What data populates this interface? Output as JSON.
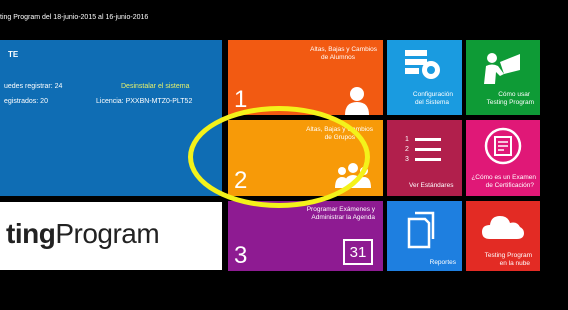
{
  "header": {
    "text": "ting Program del 18-junio-2015 al 16-junio-2016"
  },
  "panel": {
    "title": "TE",
    "can_register": "uedes registrar: 24",
    "uninstall_link": "Desinstalar el sistema",
    "registered": "egistrados: 20",
    "license": "Licencia: PXXBN-MTZ0-PLT52"
  },
  "brand": {
    "bold": "ting",
    "light": "Program"
  },
  "tiles": {
    "altas_alumnos": {
      "label1": "Altas, Bajas y Cambios",
      "label2": "de Alumnos",
      "number": "1"
    },
    "altas_grupos": {
      "label1": "Altas, Bajas y Cambios",
      "label2": "de Grupos",
      "number": "2"
    },
    "programar_agenda": {
      "label1": "Programar Exámenes y",
      "label2": "Administrar la Agenda",
      "number": "3",
      "calendar_day": "31"
    },
    "configuracion": {
      "label1": "Configuración",
      "label2": "del Sistema"
    },
    "como_usar": {
      "label1": "Cómo usar",
      "label2": "Testing Program"
    },
    "ver_estandares": {
      "label": "Ver Estándares",
      "list_nums": [
        "1",
        "2",
        "3"
      ]
    },
    "examen": {
      "label1": "¿Cómo es un  Examen",
      "label2": "de Certificación?"
    },
    "reportes": {
      "label": "Reportes"
    },
    "nube": {
      "label1": "Testing Program",
      "label2": "en la nube"
    }
  },
  "colors": {
    "highlight": "#f4f21a",
    "orange": "#f25a12",
    "amber": "#f79a08",
    "purple": "#8e1b92",
    "blue": "#1a9be0",
    "green": "#0e9b36",
    "maroon": "#b11f4c",
    "pink": "#e01877",
    "red": "#e32b24",
    "panel_blue": "#0f6db4"
  },
  "icons": [
    "person-icon",
    "group-icon",
    "calendar-icon",
    "settings-icon",
    "teacher-icon",
    "list-icon",
    "certificate-icon",
    "documents-icon",
    "cloud-icon"
  ]
}
